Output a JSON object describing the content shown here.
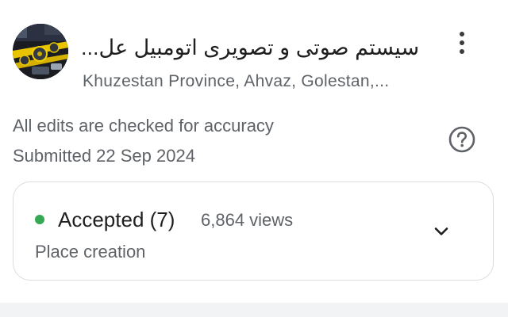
{
  "place": {
    "title": "سیستم صوتی و تصویری اتومبیل عل...",
    "address": "Khuzestan Province, Ahvaz, Golestan,...",
    "avatar_icon": "place-photo",
    "more_icon": "more-vert-icon"
  },
  "info": {
    "accuracy_note": "All edits are checked for accuracy",
    "submitted": "Submitted 22 Sep 2024",
    "help_icon": "help-circle-icon"
  },
  "edit": {
    "status": "Accepted (7)",
    "status_color": "#34a853",
    "views": "6,864 views",
    "type": "Place creation",
    "expand_icon": "chevron-down-icon"
  },
  "colors": {
    "primary_text": "#1f1f1f",
    "secondary_text": "#5f6368",
    "card_border": "#dadce0"
  }
}
